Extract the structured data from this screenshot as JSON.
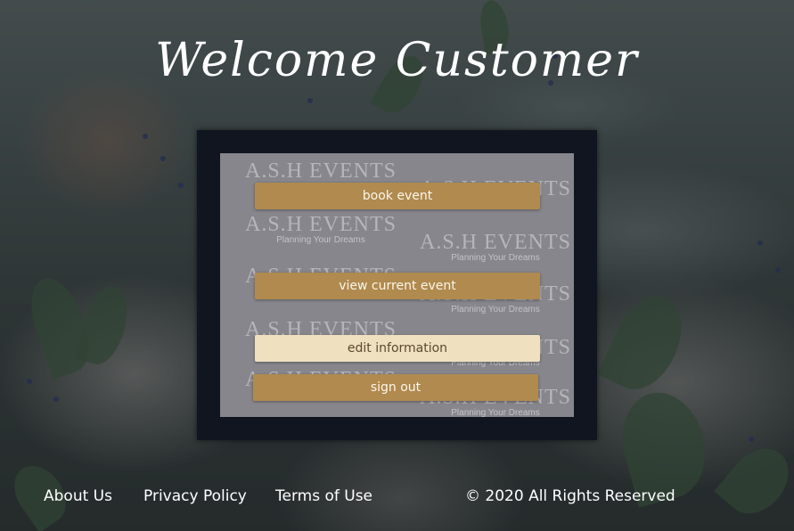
{
  "header": {
    "title": "Welcome Customer"
  },
  "panel": {
    "watermark": {
      "title": "A.S.H EVENTS",
      "subtitle": "Planning Your Dreams"
    },
    "buttons": [
      {
        "label": "book event"
      },
      {
        "label": "view current event"
      },
      {
        "label": "edit information",
        "state": "active"
      },
      {
        "label": "sign out"
      }
    ]
  },
  "footer": {
    "links": [
      {
        "label": "About Us"
      },
      {
        "label": "Privacy Policy"
      },
      {
        "label": "Terms of Use"
      }
    ],
    "copyright": "© 2020 All Rights Reserved"
  },
  "colors": {
    "button": "#b08a4e",
    "button_active": "#efe0bf",
    "frame": "#101520",
    "panel": "#96969b"
  }
}
